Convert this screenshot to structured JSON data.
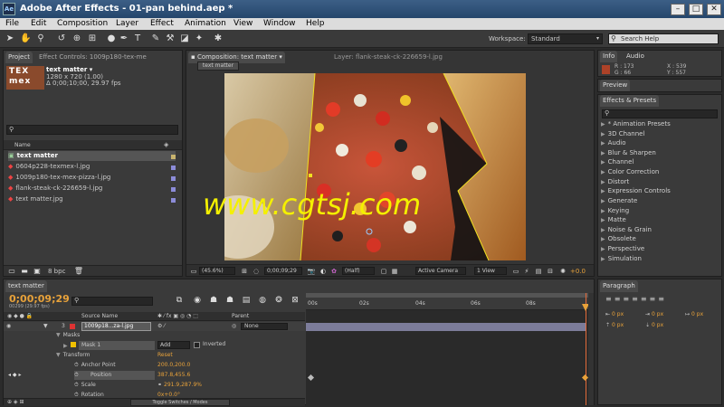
{
  "titlebar": {
    "app_icon": "Ae",
    "title": "Adobe After Effects - 01-pan behind.aep *",
    "minimize": "–",
    "maximize": "□",
    "close": "✕"
  },
  "menu": [
    "File",
    "Edit",
    "Composition",
    "Layer",
    "Effect",
    "Animation",
    "View",
    "Window",
    "Help"
  ],
  "toolbar": {
    "workspace_label": "Workspace:",
    "workspace_value": "Standard",
    "search_placeholder": "Search Help"
  },
  "project": {
    "tab_project": "Project",
    "tab_effect_controls": "Effect Controls: 1009p180-tex-me",
    "thumb_text": "TEX mex",
    "item_name": "text matter ▾",
    "item_dims": "1280 x 720 (1.00)",
    "item_duration": "Δ 0;00;10;00, 29.97 fps",
    "col_name": "Name",
    "items": [
      "text matter",
      "0604p228-texmex-l.jpg",
      "1009p180-tex-mex-pizza-l.jpg",
      "flank-steak-ck-226659-l.jpg",
      "text matter.jpg"
    ],
    "bpc": "8 bpc"
  },
  "composition": {
    "tab_comp": "Composition: text matter",
    "tab_layer": "Layer: flank-steak-ck-226659-l.jpg",
    "subtab": "text matter",
    "zoom": "(45.6%)",
    "timecode": "0;00;09;29",
    "resolution": "(Half)",
    "camera": "Active Camera",
    "view": "1 View",
    "exposure": "+0.0"
  },
  "info": {
    "tab_info": "Info",
    "tab_audio": "Audio",
    "r": "R : 173",
    "g": "G : 66",
    "x": "X : 539",
    "y": "Y : 557"
  },
  "preview": {
    "tab": "Preview"
  },
  "effects": {
    "tab": "Effects & Presets",
    "items": [
      "* Animation Presets",
      "3D Channel",
      "Audio",
      "Blur & Sharpen",
      "Channel",
      "Color Correction",
      "Distort",
      "Expression Controls",
      "Generate",
      "Keying",
      "Matte",
      "Noise & Grain",
      "Obsolete",
      "Perspective",
      "Simulation"
    ]
  },
  "timeline": {
    "tab": "text matter",
    "timecode": "0;00;09;29",
    "frames": "00299 (29.97 fps)",
    "col_source": "Source Name",
    "col_parent": "Parent",
    "layer_num": "3",
    "layer_name": "1009p18...za-l.jpg",
    "parent_value": "None",
    "masks": "Masks",
    "mask1": "Mask 1",
    "mask_mode": "Add",
    "inverted": "Inverted",
    "transform": "Transform",
    "reset": "Reset",
    "anchor_label": "Anchor Point",
    "anchor_value": "200.0,200.0",
    "position_label": "Position",
    "position_value": "387.8,455.6",
    "scale_label": "Scale",
    "scale_value": "291.9,287.9%",
    "rotation_label": "Rotation",
    "rotation_value": "0x+0.0°",
    "toggle": "Toggle Switches / Modes",
    "ruler": [
      "00s",
      "02s",
      "04s",
      "06s",
      "08s"
    ]
  },
  "paragraph": {
    "tab": "Paragraph",
    "px1": "0 px",
    "px2": "0 px",
    "px3": "0 px",
    "px4": "0 px",
    "px5": "0 px"
  },
  "watermark": "www.cgtsj.com"
}
